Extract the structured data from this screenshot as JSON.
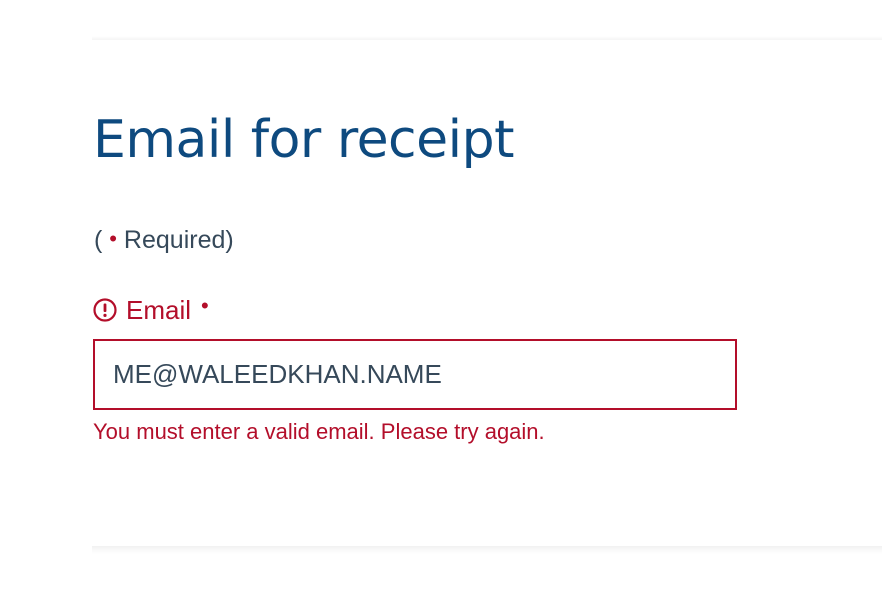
{
  "form": {
    "title": "Email for receipt",
    "required_note": {
      "open": "( ",
      "marker": "•",
      "text": " Required)"
    },
    "email_field": {
      "label": "Email",
      "required_marker": "•",
      "value": "ME@WALEEDKHAN.NAME",
      "error_message": "You must enter a valid email. Please try again.",
      "status_icon": "alert-circle-icon"
    }
  },
  "colors": {
    "title": "#0e4a7f",
    "text": "#36495a",
    "error": "#b30e2a"
  }
}
